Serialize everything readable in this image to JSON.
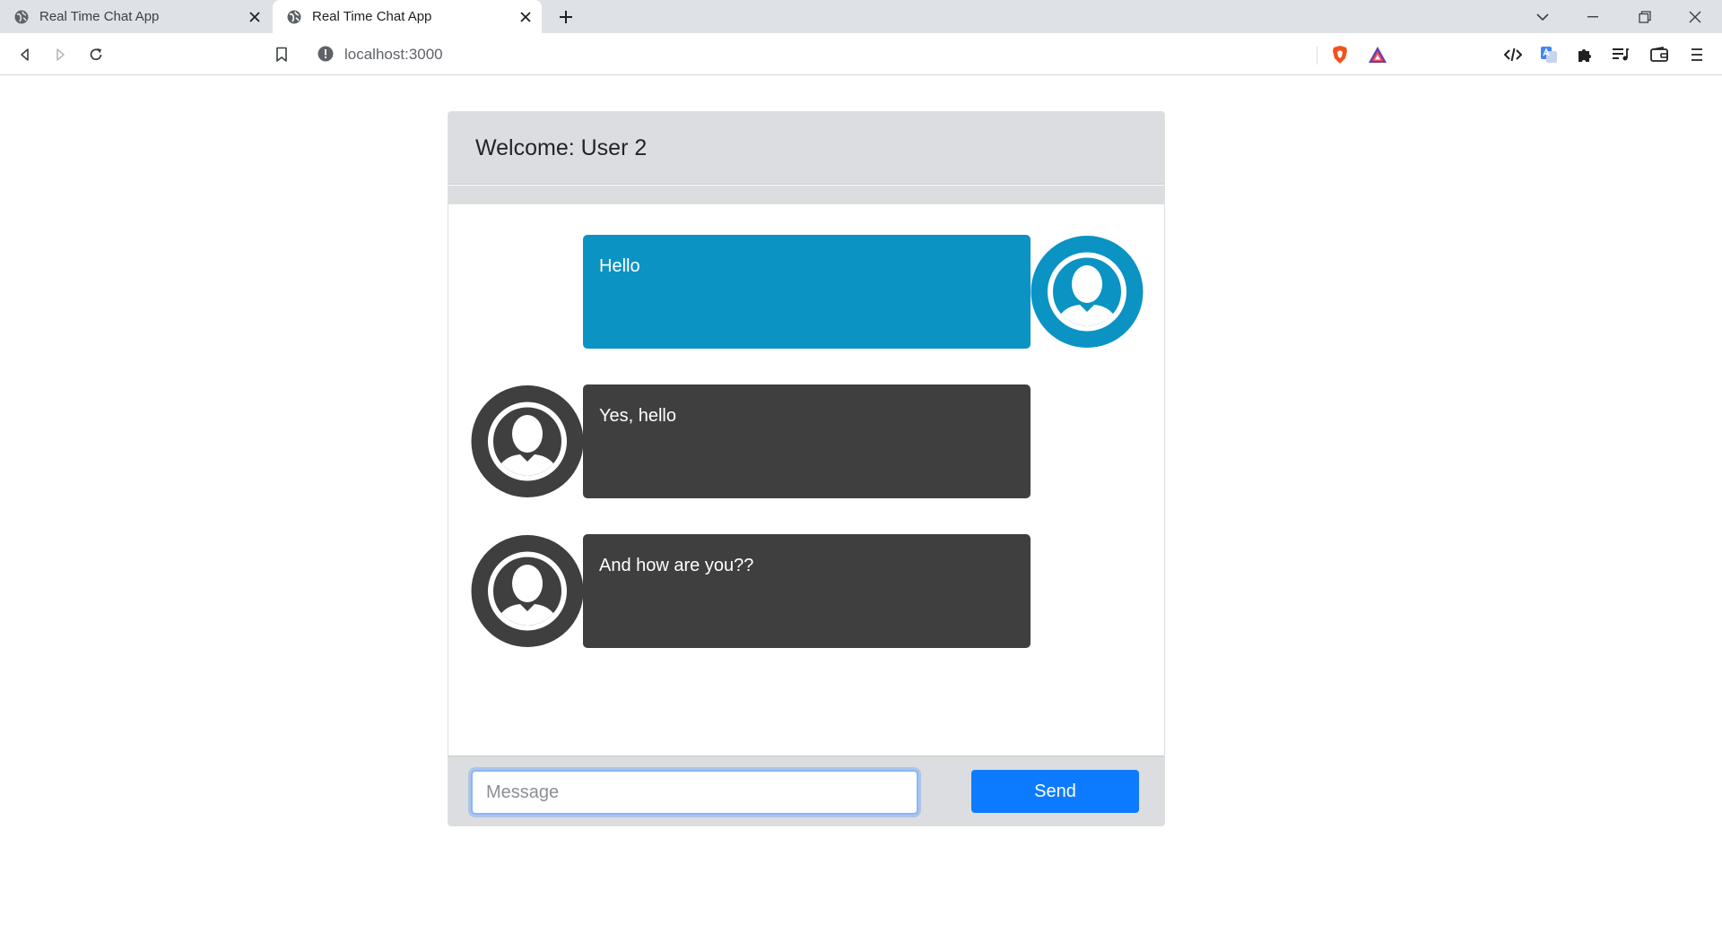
{
  "browser": {
    "tabs": [
      {
        "title": "Real Time Chat App",
        "active": false
      },
      {
        "title": "Real Time Chat App",
        "active": true
      }
    ],
    "url": "localhost:3000"
  },
  "chat": {
    "header_title": "Welcome: User 2",
    "messages": [
      {
        "text": "Hello",
        "side": "right",
        "color": "#0b93c4"
      },
      {
        "text": "Yes, hello",
        "side": "left",
        "color": "#3f3f3f"
      },
      {
        "text": "And how are you??",
        "side": "left",
        "color": "#3f3f3f"
      }
    ],
    "input_placeholder": "Message",
    "send_label": "Send"
  },
  "colors": {
    "header_bg": "#dcdde0",
    "own_bubble": "#0b93c4",
    "other_bubble": "#3f3f3f",
    "send_button": "#0d7bff"
  }
}
